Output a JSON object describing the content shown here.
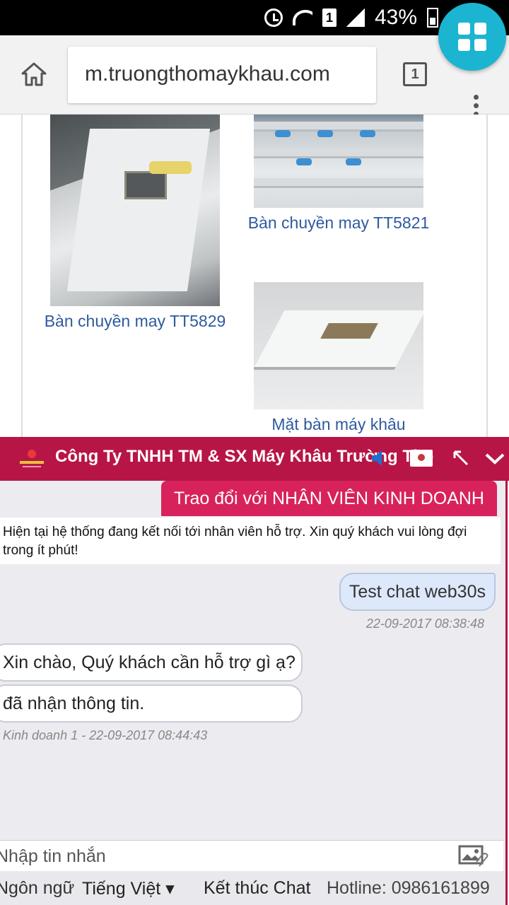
{
  "status_bar": {
    "sim_slot": "1",
    "battery_percent": "43%",
    "icons": [
      "alarm-icon",
      "wifi-icon",
      "sim-icon",
      "signal-icon",
      "battery-icon"
    ]
  },
  "browser": {
    "url": "m.truongthomaykhau.com",
    "tab_count": "1"
  },
  "products": [
    {
      "name": "Bàn chuyền may TT5829"
    },
    {
      "name": "Bàn chuyền may TT5821"
    },
    {
      "name": "Mặt bàn máy khâu"
    }
  ],
  "chat": {
    "title": "Công Ty TNHH TM & SX Máy Khâu Trường Thọ",
    "department_button": "Trao đổi với NHÂN VIÊN KINH DOANH",
    "system_notice": "Hiện tại hệ thống đang kết nối tới nhân viên hỗ trợ. Xin quý khách vui lòng đợi trong ít phút!",
    "messages": {
      "outgoing_1": "Test chat web30s",
      "outgoing_1_time": "22-09-2017 08:38:48",
      "incoming_1": "Xin chào, Quý khách cần hỗ trợ gì ạ?",
      "incoming_2": "đã nhận thông tin.",
      "incoming_meta": "Kinh doanh 1 - 22-09-2017 08:44:43"
    },
    "input_placeholder": "Nhập tin nhắn",
    "footer": {
      "language_label": "Ngôn ngữ",
      "language_value": "Tiếng Việt ▾",
      "end_chat": "Kết thúc Chat",
      "hotline": "Hotline: 0986161899"
    }
  },
  "colors": {
    "chat_header": "#b81547",
    "department_button": "#d8225b",
    "apps_fab": "#1bb5d1",
    "product_link": "#2e5aa0"
  }
}
